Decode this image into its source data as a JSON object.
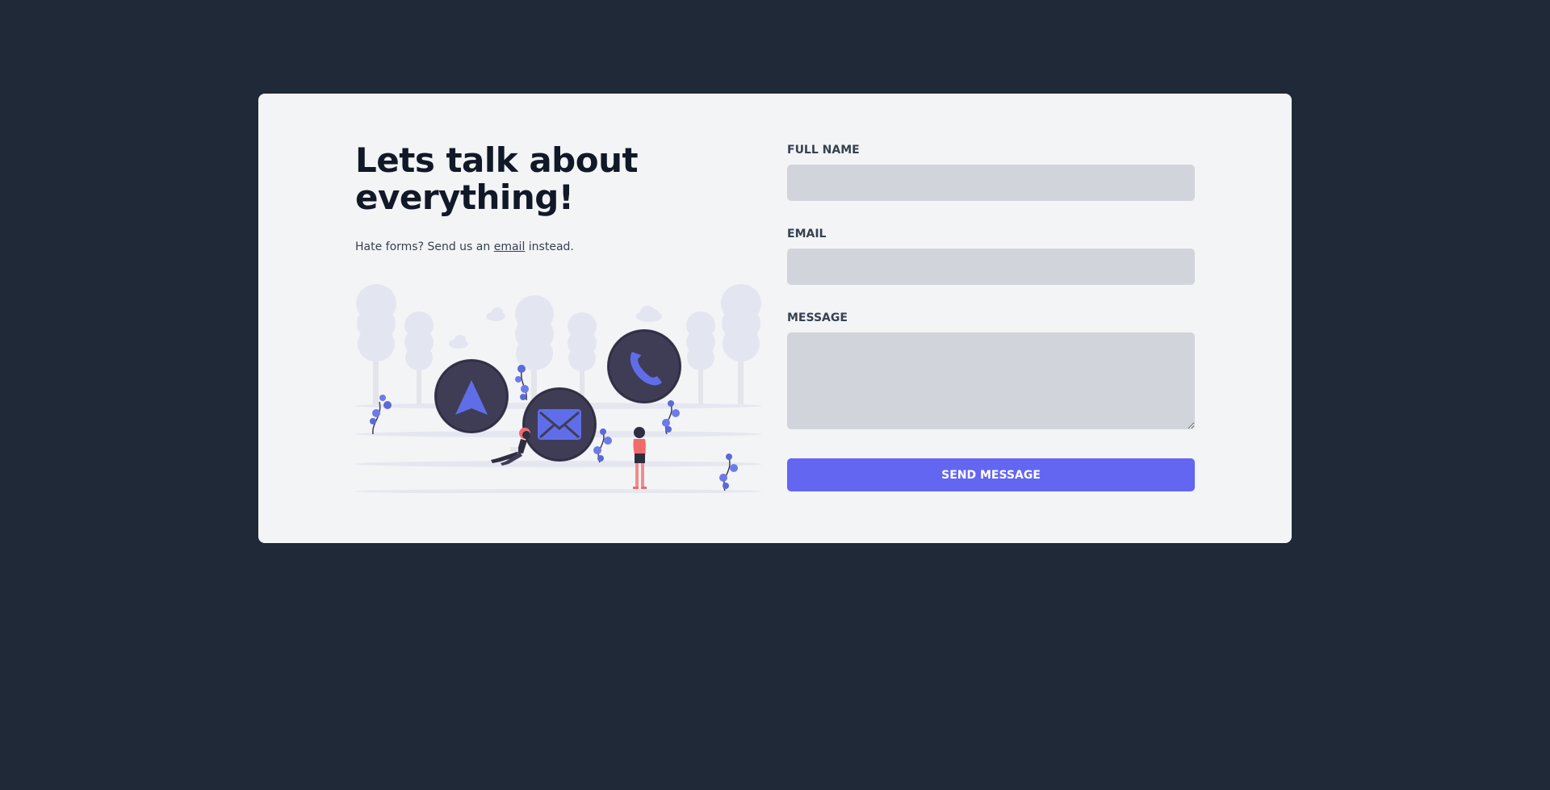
{
  "hero": {
    "headline": "Lets talk about everything!",
    "subtitle_before": "Hate forms? Send us an ",
    "subtitle_link": "email",
    "subtitle_after": " instead."
  },
  "form": {
    "full_name_label": "FULL NAME",
    "full_name_value": "",
    "email_label": "EMAIL",
    "email_value": "",
    "message_label": "MESSAGE",
    "message_value": "",
    "submit_label": "SEND MESSAGE"
  },
  "illustration": {
    "icons": [
      "navigation-arrow-icon",
      "envelope-icon",
      "phone-icon"
    ]
  },
  "colors": {
    "page_bg": "#202938",
    "card_bg": "#f3f4f6",
    "input_bg": "#d1d5db",
    "accent": "#6366f1",
    "heading": "#111827",
    "circle": "#3f3d56",
    "figure_accent": "#f26b6b"
  }
}
